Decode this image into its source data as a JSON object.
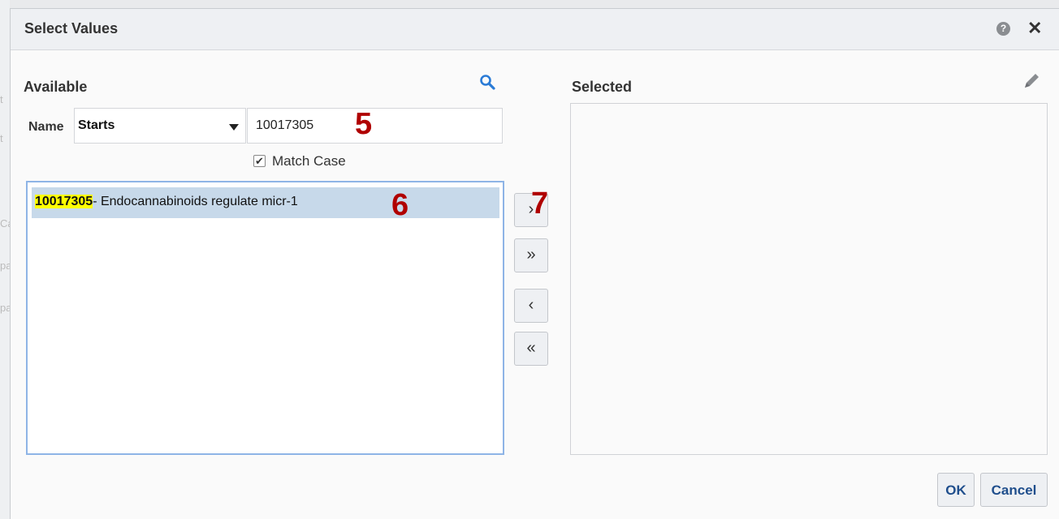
{
  "dialog": {
    "title": "Select Values",
    "help_icon": "help-icon",
    "close_icon": "close-icon",
    "help_glyph": "?",
    "close_glyph": "✕"
  },
  "available": {
    "label": "Available",
    "search_icon": "search-icon",
    "name_label": "Name",
    "operator_value": "Starts",
    "search_value": "10017305",
    "match_case_label": "Match Case",
    "match_case_checked": true,
    "items": [
      {
        "match": "10017305",
        "rest": "- Endocannabinoids regulate micr-1",
        "selected": true
      }
    ]
  },
  "shuttle": {
    "move_right": "›",
    "move_all_right": "»",
    "move_left": "‹",
    "move_all_left": "«"
  },
  "selected": {
    "label": "Selected",
    "edit_icon": "pencil-icon",
    "items": []
  },
  "buttons": {
    "ok": "OK",
    "cancel": "Cancel"
  },
  "annotations": {
    "a5": "5",
    "a6": "6",
    "a7": "7"
  },
  "colors": {
    "highlight": "#ffff00",
    "annotation": "#b00000",
    "row_selected": "#c7d9ea",
    "accent": "#1f4e8c",
    "search_icon": "#2a7bd6"
  },
  "background_fragments": [
    "t",
    "t",
    "Ca",
    "pa",
    "pa"
  ]
}
